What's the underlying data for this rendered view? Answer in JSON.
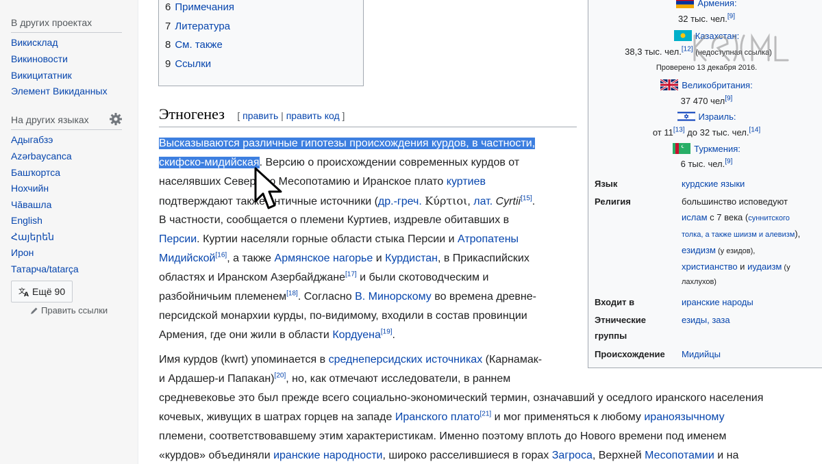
{
  "sidebar": {
    "projects_heading": "В других проектах",
    "projects": [
      "Викисклад",
      "Викиновости",
      "Викицитатник",
      "Элемент Викиданных"
    ],
    "languages_heading": "На других языках",
    "languages": [
      "Адыгабзэ",
      "Azərbaycanca",
      "Башҡортса",
      "Нохчийн",
      "Чăвашла",
      "English",
      "Հայերեն",
      "Ирон",
      "Татарча/tatarça"
    ],
    "more_label": "Ещё 90",
    "edit_links_label": "Править ссылки"
  },
  "toc": {
    "items": [
      {
        "num": "6",
        "label": "Примечания"
      },
      {
        "num": "7",
        "label": "Литература"
      },
      {
        "num": "8",
        "label": "См. также"
      },
      {
        "num": "9",
        "label": "Ссылки"
      }
    ]
  },
  "section": {
    "title": "Этногенез",
    "edit_open": "[",
    "edit_label": "править",
    "edit_sep": "|",
    "edit_code_label": "править код",
    "edit_close": "]"
  },
  "para1": {
    "l1_hl": "Высказываются различные гипотезы происхождения курдов, в частности,",
    "l2_hl": "скифско-мидийская",
    "l2_rest": ". Версию о происхождении современных курдов от",
    "l3_a": "населявших Северную Месопотамию и Иранское плато",
    "l3_link": "куртиев",
    "l4_a": "подтверждают также античные источники (",
    "l4_link1": "др.-греч.",
    "l4_greek": "Κύρτιοι",
    "l4_comma": ", ",
    "l4_link2": "лат.",
    "l4_lat": "Cyrtii",
    "l4_ref": "[15]",
    "l4_end": ".",
    "l5": "В частности, сообщается о племени Куртиев, издревле обитавших в",
    "l6_link1": "Персии",
    "l6_a": ". Куртии населяли горные области стыка Персии и",
    "l6_link2": "Атропатены",
    "l7_link1": "Мидийской",
    "l7_ref": "[16]",
    "l7_a": ", а также",
    "l7_link2": "Армянское нагорье",
    "l7_b": "и",
    "l7_link3": "Курдистан",
    "l7_c": ", в Прикаспийских",
    "l8_a": "областях и Иранском Азербайджане",
    "l8_ref": "[17]",
    "l8_b": "и были скотоводческим и",
    "l9_a": "разбойничьим племенем",
    "l9_ref": "[18]",
    "l9_b": ". Согласно",
    "l9_link": "В. Минорскому",
    "l9_c": "во времена древне-",
    "l10": "персидской монархии курды, по-видимому, входили в состав провинции",
    "l11_a": "Армения, где они жили в области",
    "l11_link": "Кордуена",
    "l11_ref": "[19]",
    "l11_end": "."
  },
  "para2": {
    "l1_a": "Имя курдов (kwrt) упоминается в",
    "l1_link": "среднеперсидских источниках",
    "l1_b": "(Карнамак-",
    "l2_a": "и Ардашер-и Папакан)",
    "l2_ref": "[20]",
    "l2_b": ", но, как отмечают исследователи, в раннем",
    "l3": "средневековье это был прежде всего социально-экономический термин, означавший у оседлого иранского населения",
    "l4_a": "кочевых, живущих в шатрах горцев на западе",
    "l4_link1": "Иранского плато",
    "l4_ref": "[21]",
    "l4_b": "и мог применяться к любому",
    "l4_link2": "ираноязычному",
    "l5": "племени, соответствовавшему этим характеристикам. Именно поэтому вплоть до Нового времени под именем",
    "l6_a": "«курдов» объединяли",
    "l6_link1": "иранские народности",
    "l6_b": ", широко расселившиеся в горах",
    "l6_link2": "Загроса",
    "l6_c": ", Верхней",
    "l6_link3": "Месопотамии",
    "l6_d": "и на"
  },
  "infobox": {
    "armenia": {
      "country": "Армения:",
      "count": "32 тыс. чел.",
      "ref": "[9]"
    },
    "kazakhstan": {
      "country": "Казахстан:",
      "count": "38,3 тыс. чел.",
      "ref": "[12]",
      "note": "(недоступная ссылка)",
      "checked": "Проверено 13 декабря 2016."
    },
    "uk": {
      "country": "Великобритания:",
      "count": "37 470 чел",
      "ref": "[9]"
    },
    "israel": {
      "country": "Израиль:",
      "from": "от 11",
      "ref1": "[13]",
      "to": " до 32 тыс. чел.",
      "ref2": "[14]"
    },
    "turkmenistan": {
      "country": "Туркмения:",
      "count": "6 тыс. чел.",
      "ref": "[9]"
    },
    "language_label": "Язык",
    "language_value": "курдские языки",
    "religion_label": "Религия",
    "religion_l1": "большинство исповедуют",
    "religion_l2_link": "ислам",
    "religion_l2_rest": " с 7 века (",
    "religion_l2_small": "суннитского",
    "religion_l3_small": "толка, а также шиизм и алевизм",
    "religion_l3_rest": "),",
    "religion_l4_link": "езидизм",
    "religion_l4_rest": " (у езидов),",
    "religion_l5_link1": "христианство",
    "religion_l5_and": " и ",
    "religion_l5_link2": "иудаизм",
    "religion_l5_rest": " (у",
    "religion_l6": "лахлухов)",
    "part_label": "Входит в",
    "part_value": "иранские народы",
    "ethnic_label_1": "Этнические",
    "ethnic_label_2": "группы",
    "ethnic_value": "езиды, заза",
    "origin_label": "Происхождение",
    "origin_value": "Мидийцы"
  },
  "colors": {
    "link": "#0645ad",
    "selection": "#3d7fe0",
    "sidebar_bg": "#f6f6f6",
    "infobox_bg": "#f8f9fa"
  },
  "icons": [
    "gear-icon",
    "translate-icon",
    "pencil-icon",
    "mouse-cursor-icon"
  ]
}
